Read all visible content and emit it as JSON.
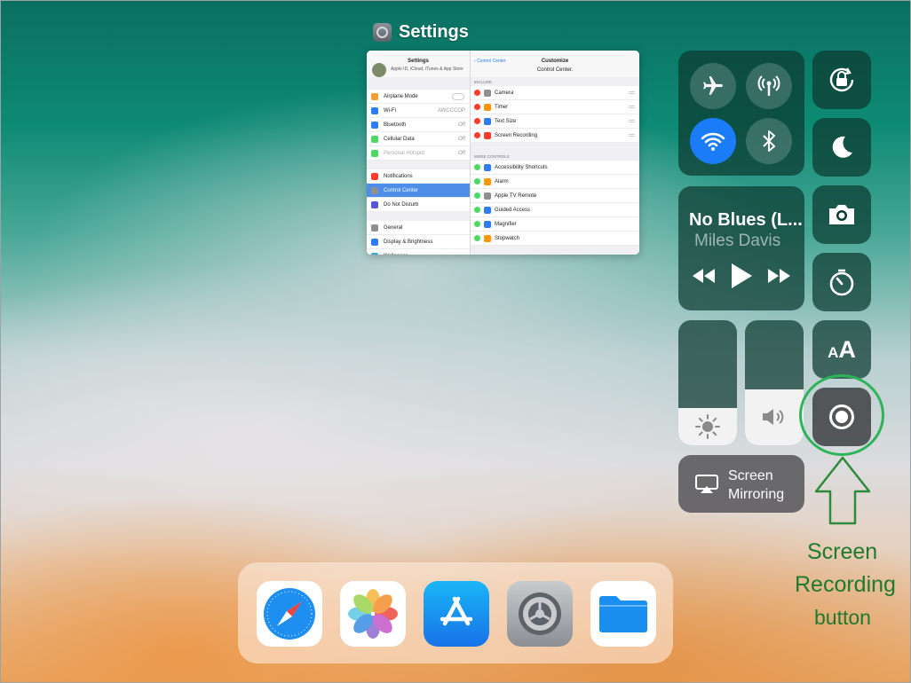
{
  "app_switcher": {
    "app_name": "Settings",
    "snapshot": {
      "left_pane": {
        "title": "Settings",
        "account_subtitle": "Apple ID, iCloud, iTunes & App Store",
        "group1": [
          {
            "label": "Airplane Mode",
            "value": "",
            "color": "#f0a030",
            "toggle": true
          },
          {
            "label": "Wi-Fi",
            "value": "AWCCCOP",
            "color": "#2e7cf6"
          },
          {
            "label": "Bluetooth",
            "value": "Off",
            "color": "#2e7cf6"
          },
          {
            "label": "Cellular Data",
            "value": "Off",
            "color": "#4cd964"
          },
          {
            "label": "Personal Hotspot",
            "value": "Off",
            "color": "#4cd964",
            "dim": true
          }
        ],
        "group2": [
          {
            "label": "Notifications",
            "color": "#ff3b30"
          },
          {
            "label": "Control Center",
            "color": "#8e8e93",
            "selected": true
          },
          {
            "label": "Do Not Disturb",
            "color": "#5856d6"
          }
        ],
        "group3": [
          {
            "label": "General",
            "color": "#8e8e93"
          },
          {
            "label": "Display & Brightness",
            "color": "#2e7cf6"
          },
          {
            "label": "Wallpaper",
            "color": "#34aadc"
          }
        ]
      },
      "right_pane": {
        "back_label": "Control Center",
        "title": "Customize",
        "subtitle": "Control Center.",
        "include_header": "INCLUDE",
        "include": [
          {
            "label": "Camera",
            "color": "#8e8e93"
          },
          {
            "label": "Timer",
            "color": "#ff9500"
          },
          {
            "label": "Text Size",
            "color": "#2e7cf6"
          },
          {
            "label": "Screen Recording",
            "color": "#ff3b30"
          }
        ],
        "more_header": "MORE CONTROLS",
        "more": [
          {
            "label": "Accessibility Shortcuts",
            "color": "#2e7cf6"
          },
          {
            "label": "Alarm",
            "color": "#ff9500"
          },
          {
            "label": "Apple TV Remote",
            "color": "#8e8e93"
          },
          {
            "label": "Guided Access",
            "color": "#2e7cf6"
          },
          {
            "label": "Magnifier",
            "color": "#2e7cf6"
          },
          {
            "label": "Stopwatch",
            "color": "#ff9500"
          }
        ]
      }
    }
  },
  "control_center": {
    "now_playing": {
      "song": "No Blues (L...",
      "artist": "Miles Davis"
    },
    "screen_mirroring_label_1": "Screen",
    "screen_mirroring_label_2": "Mirroring",
    "text_size_glyph": "AA",
    "brightness_level": 0.3,
    "volume_level": 0.45
  },
  "annotation": {
    "line1": "Screen",
    "line2": "Recording",
    "line3": "button",
    "color": "#1e7a2e"
  },
  "dock": {
    "apps": [
      "safari-icon",
      "photos-icon",
      "app-store-icon",
      "settings-icon",
      "files-icon"
    ]
  }
}
